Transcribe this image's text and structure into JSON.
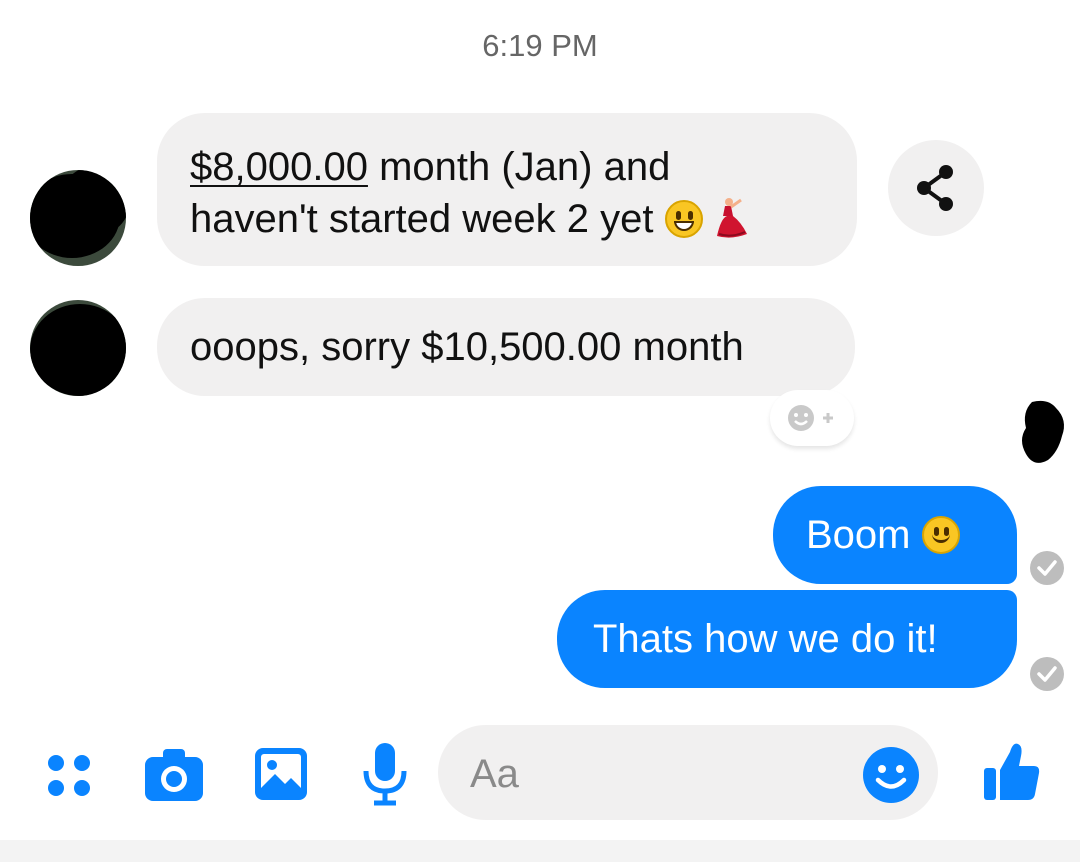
{
  "header": {
    "timestamp": "6:19 PM"
  },
  "messages": [
    {
      "direction": "incoming",
      "line1_amount": "$8,000.00",
      "line1_rest": " month (Jan) and",
      "line2": "haven't started week 2 yet",
      "emojis": [
        "grinning-face-emoji",
        "dancer-emoji"
      ]
    },
    {
      "direction": "incoming",
      "text": "ooops, sorry $10,500.00 month"
    },
    {
      "direction": "outgoing",
      "text": "Boom",
      "emojis": [
        "smiling-face-emoji"
      ],
      "status": "sent-check-icon"
    },
    {
      "direction": "outgoing",
      "text": "Thats how we do it!",
      "status": "sent-check-icon"
    }
  ],
  "composer": {
    "placeholder": "Aa",
    "icons": [
      "more-apps-icon",
      "camera-icon",
      "gallery-icon",
      "microphone-icon",
      "emoji-icon",
      "like-thumb-icon"
    ]
  },
  "colors": {
    "accent": "#0a84ff",
    "incoming_bubble": "#f1f0f0",
    "timestamp": "#666666"
  }
}
